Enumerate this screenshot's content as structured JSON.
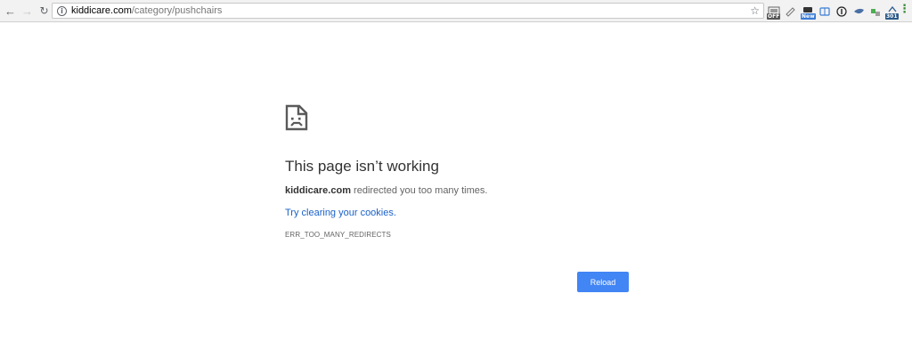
{
  "browser": {
    "url_host": "kiddicare.com",
    "url_path": "/category/pushchairs",
    "extensions": [
      {
        "name": "tab-off-extension",
        "badge": "OFF",
        "badge_color": "#555555"
      },
      {
        "name": "pen-extension",
        "badge": "",
        "badge_color": ""
      },
      {
        "name": "new-badge-extension",
        "badge": "New",
        "badge_color": "#3a7bd5"
      },
      {
        "name": "window-extension",
        "badge": "",
        "badge_color": ""
      },
      {
        "name": "onepassword-extension",
        "badge": "",
        "badge_color": ""
      },
      {
        "name": "bird-extension",
        "badge": "",
        "badge_color": ""
      },
      {
        "name": "puzzle-extension",
        "badge": "",
        "badge_color": ""
      },
      {
        "name": "redirect-301-extension",
        "badge": "301",
        "badge_color": "#2b5a8a"
      }
    ]
  },
  "error": {
    "title": "This page isn’t working",
    "host": "kiddicare.com",
    "message_rest": " redirected you too many times.",
    "suggestion": "Try clearing your cookies.",
    "code": "ERR_TOO_MANY_REDIRECTS",
    "reload_label": "Reload"
  },
  "colors": {
    "accent": "#4285f4",
    "link": "#1a61c8"
  }
}
